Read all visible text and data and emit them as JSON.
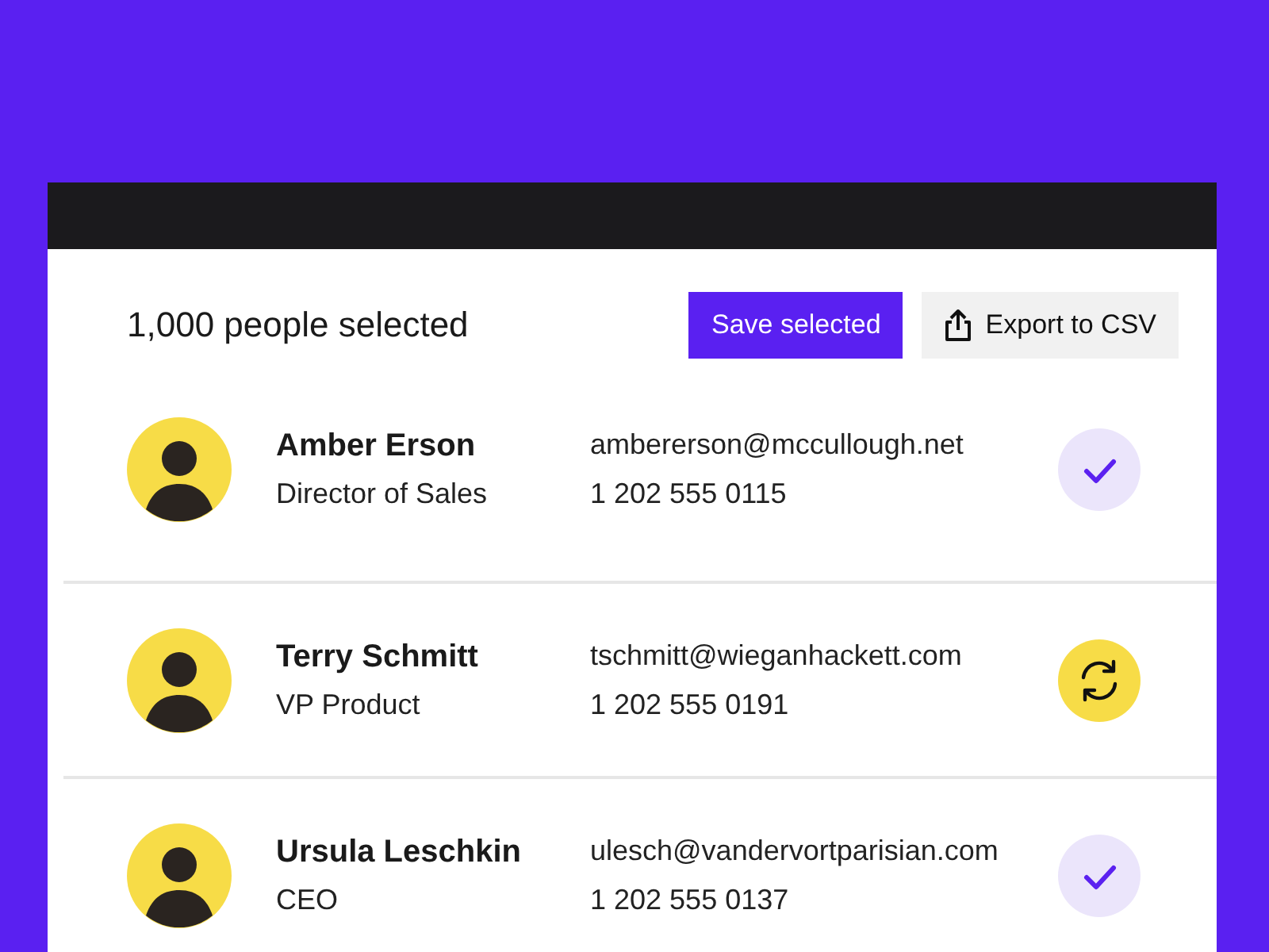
{
  "header": {
    "count_label": "1,000 people selected",
    "save_button": "Save selected",
    "export_button": "Export to CSV"
  },
  "people": [
    {
      "name": "Amber Erson",
      "title": "Director of Sales",
      "email": "ambererson@mccullough.net",
      "phone": "1 202 555 0115",
      "kind": "done"
    },
    {
      "name": "Terry Schmitt",
      "title": "VP Product",
      "email": "tschmitt@wieganhackett.com",
      "phone": "1 202 555 0191",
      "kind": "syncing"
    },
    {
      "name": "Ursula Leschkin",
      "title": "CEO",
      "email": "ulesch@vandervortparisian.com",
      "phone": "1 202 555 0137",
      "kind": "done"
    }
  ]
}
